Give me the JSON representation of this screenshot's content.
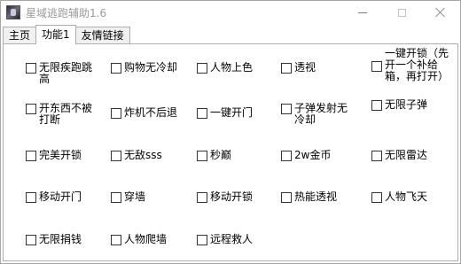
{
  "window": {
    "title": "星域逃跑辅助1.6"
  },
  "tabs": [
    {
      "label": "主页"
    },
    {
      "label": "功能1"
    },
    {
      "label": "友情链接"
    }
  ],
  "options": {
    "r1c1": "无限疾跑跳高",
    "r1c2": "购物无冷却",
    "r1c3": "人物上色",
    "r1c4": "透视",
    "r1c5": "一键开锁（先开一个补给箱，再打开）",
    "r2c1": "开东西不被打断",
    "r2c2": "炸机不后退",
    "r2c3": "一键开门",
    "r2c4": "子弹发射无冷却",
    "r2c5": "无限子弹",
    "r3c1": "完美开锁",
    "r3c2": "无敌sss",
    "r3c3": "秒巅",
    "r3c4": "2w金币",
    "r3c5": "无限雷达",
    "r4c1": "移动开门",
    "r4c2": "穿墙",
    "r4c3": "移动开锁",
    "r4c4": "热能透视",
    "r4c5": "人物飞天",
    "r5c1": "无限捐钱",
    "r5c2": "人物爬墙",
    "r5c3": "远程救人"
  }
}
